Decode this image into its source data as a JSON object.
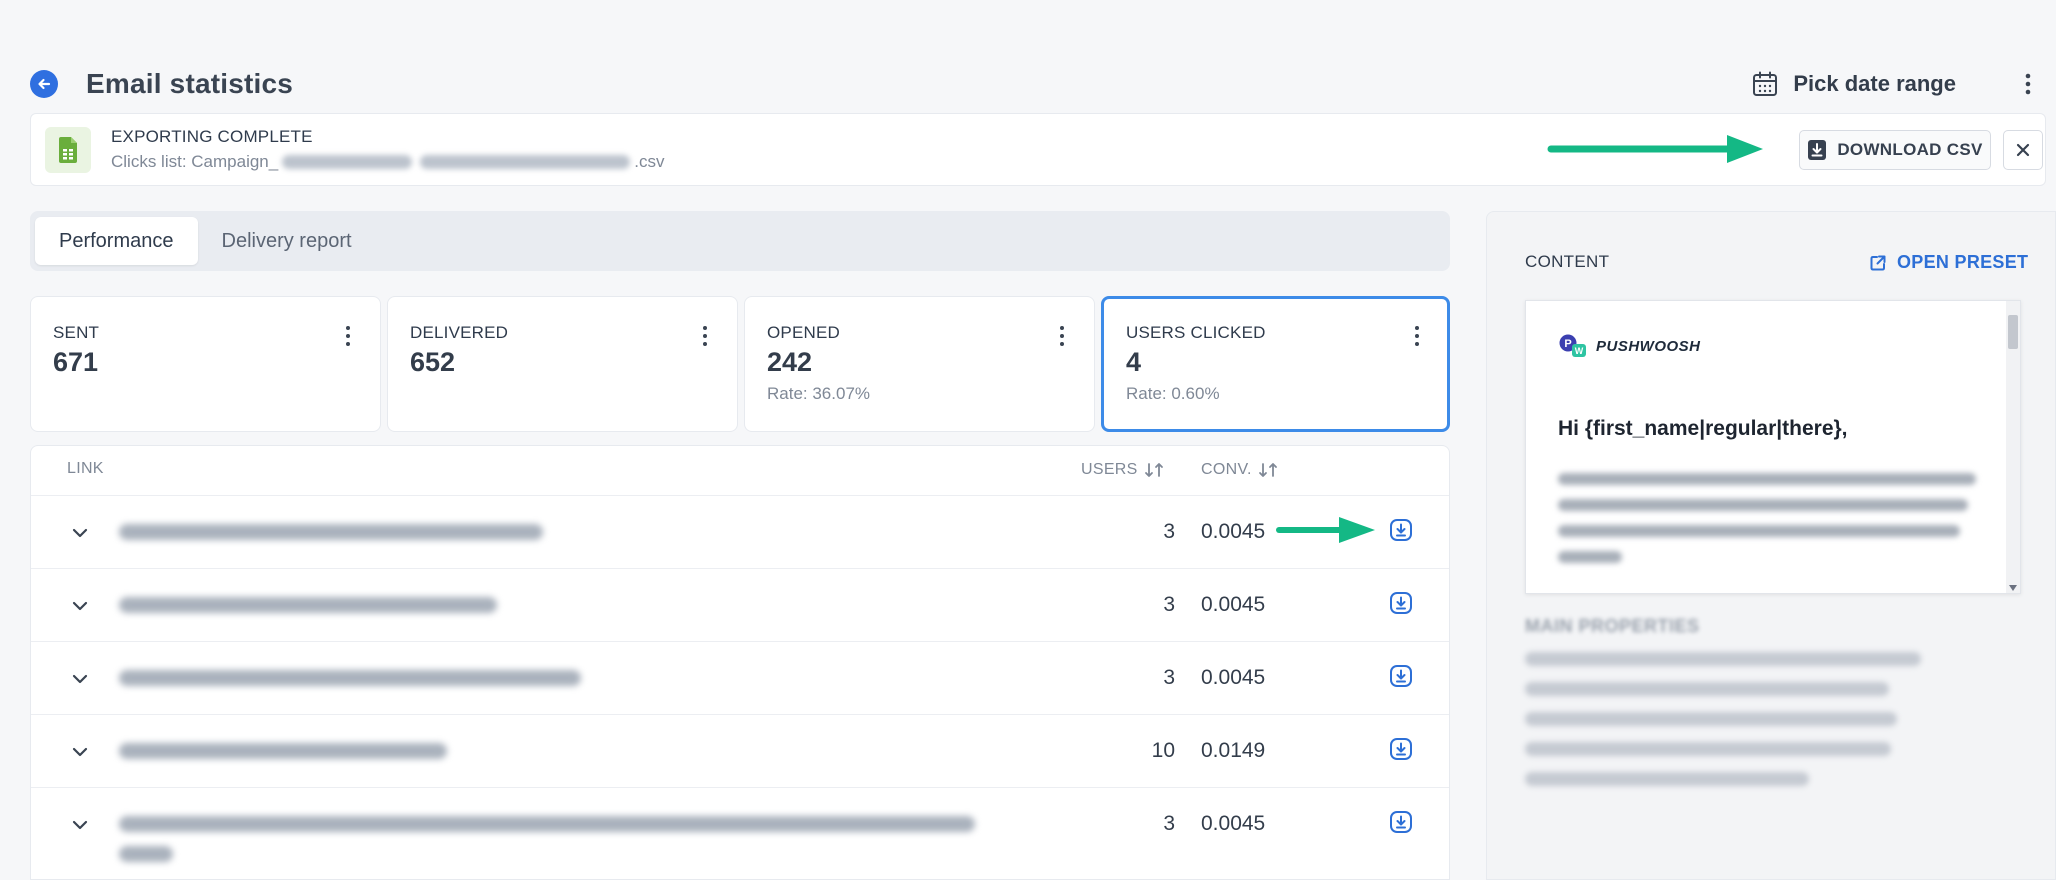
{
  "header": {
    "title": "Email statistics",
    "date_range_label": "Pick date range"
  },
  "export_banner": {
    "title": "EXPORTING COMPLETE",
    "subtitle_prefix": "Clicks list: Campaign_",
    "subtitle_suffix": ".csv",
    "download_label": "DOWNLOAD CSV"
  },
  "tabs": [
    {
      "label": "Performance",
      "active": true
    },
    {
      "label": "Delivery report",
      "active": false
    }
  ],
  "stats": [
    {
      "label": "SENT",
      "value": "671",
      "rate": ""
    },
    {
      "label": "DELIVERED",
      "value": "652",
      "rate": ""
    },
    {
      "label": "OPENED",
      "value": "242",
      "rate": "Rate: 36.07%"
    },
    {
      "label": "USERS CLICKED",
      "value": "4",
      "rate": "Rate: 0.60%",
      "selected": true
    }
  ],
  "links_table": {
    "columns": {
      "link": "LINK",
      "users": "USERS",
      "conv": "CONV."
    },
    "rows": [
      {
        "users": "3",
        "conv": "0.0045"
      },
      {
        "users": "3",
        "conv": "0.0045"
      },
      {
        "users": "3",
        "conv": "0.0045"
      },
      {
        "users": "10",
        "conv": "0.0149"
      },
      {
        "users": "3",
        "conv": "0.0045"
      }
    ]
  },
  "content_panel": {
    "label": "CONTENT",
    "open_preset_label": "OPEN PRESET",
    "brand_name": "PUSHWOOSH",
    "greeting": "Hi {first_name|regular|there},",
    "main_properties_label": "MAIN PROPERTIES"
  },
  "colors": {
    "accent": "#2d6fd6",
    "selected_border": "#3d8be8",
    "arrow": "#14b885",
    "file_icon": "#6aae3c"
  }
}
